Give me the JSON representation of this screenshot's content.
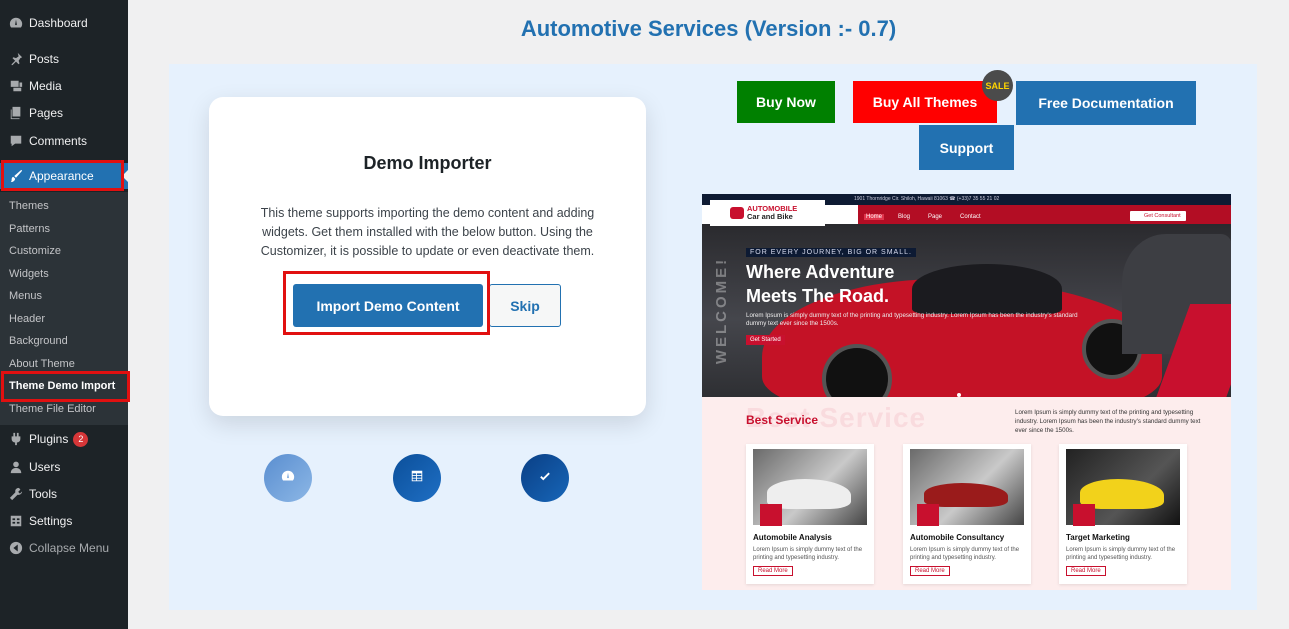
{
  "sidebar": {
    "items": [
      {
        "label": "Dashboard",
        "icon": "dashboard-icon"
      },
      {
        "label": "Posts",
        "icon": "pin-icon"
      },
      {
        "label": "Media",
        "icon": "media-icon"
      },
      {
        "label": "Pages",
        "icon": "pages-icon"
      },
      {
        "label": "Comments",
        "icon": "comment-icon"
      },
      {
        "label": "Appearance",
        "icon": "brush-icon"
      },
      {
        "label": "Plugins",
        "icon": "plugin-icon",
        "badge": "2"
      },
      {
        "label": "Users",
        "icon": "user-icon"
      },
      {
        "label": "Tools",
        "icon": "wrench-icon"
      },
      {
        "label": "Settings",
        "icon": "settings-icon"
      },
      {
        "label": "Collapse Menu",
        "icon": "collapse-icon"
      }
    ],
    "submenu": [
      "Themes",
      "Patterns",
      "Customize",
      "Widgets",
      "Menus",
      "Header",
      "Background",
      "About Theme",
      "Theme Demo Import",
      "Theme File Editor"
    ]
  },
  "page": {
    "title": "Automotive Services (Version :- 0.7)"
  },
  "importer": {
    "heading": "Demo Importer",
    "description": "This theme supports importing the demo content and adding widgets. Get them installed with the below button. Using the Customizer, it is possible to update or even deactivate them.",
    "import_label": "Import Demo Content",
    "skip_label": "Skip"
  },
  "actions": {
    "buy_now": "Buy Now",
    "buy_all": "Buy All Themes",
    "sale": "SALE",
    "free_docs": "Free Documentation",
    "support": "Support"
  },
  "steps": [
    {
      "icon": "dashboard-icon"
    },
    {
      "icon": "table-icon"
    },
    {
      "icon": "check-icon"
    }
  ],
  "preview": {
    "logo_line1": "AUTOMOBILE",
    "logo_line2": "Car and Bike",
    "contact": "1901 Thornridge Cir. Shiloh, Hawaii 81063   ☎ (+33)7 35 55 21 02",
    "nav": [
      "Home",
      "Blog",
      "Page",
      "Contact"
    ],
    "consult": "Get Consultant",
    "welcome": "WELCOME!",
    "tagline": "FOR EVERY JOURNEY, BIG OR SMALL.",
    "hero_title": "Where Adventure Meets The Road.",
    "hero_text": "Lorem Ipsum is simply dummy text of the printing and typesetting industry. Lorem Ipsum has been the industry's standard dummy text ever since the 1500s.",
    "hero_btn": "Get Started",
    "section_title": "Best Service",
    "section_text": "Lorem Ipsum is simply dummy text of the printing and typesetting industry. Lorem Ipsum has been the industry's standard dummy text ever since the 1500s.",
    "services": [
      {
        "title": "Automobile  Analysis",
        "text": "Lorem Ipsum is simply dummy text of the printing and typesetting industry.",
        "btn": "Read More"
      },
      {
        "title": "Automobile  Consultancy",
        "text": "Lorem Ipsum is simply dummy text of the printing and typesetting industry.",
        "btn": "Read More"
      },
      {
        "title": "Target Marketing",
        "text": "Lorem Ipsum is simply dummy text of the printing and typesetting industry.",
        "btn": "Read More"
      }
    ]
  },
  "colors": {
    "sidebar_bg": "#1d2327",
    "accent": "#2271b1",
    "highlight": "#e11010",
    "buy_now": "#008000",
    "buy_all": "#ff0000"
  }
}
